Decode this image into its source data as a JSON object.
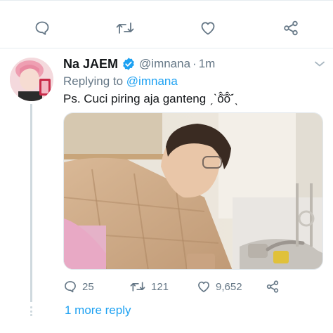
{
  "top_actions": {
    "reply_icon": "reply-icon",
    "retweet_icon": "retweet-icon",
    "like_icon": "heart-icon",
    "share_icon": "share-icon"
  },
  "tweet": {
    "display_name": "Na JAEM",
    "handle": "@imnana",
    "separator": "·",
    "time": "1m",
    "replying_prefix": "Replying to",
    "replying_to": "@imnana",
    "text": "Ps. Cuci piring aja ganteng ˏˋô̂̆ô̂̆ˊˎ",
    "media_alt": "Person washing dishes at a kitchen sink",
    "counts": {
      "replies": "25",
      "retweets": "121",
      "likes": "9,652"
    }
  },
  "thread": {
    "more_reply_label": "1 more reply"
  },
  "colors": {
    "accent": "#1da1f2",
    "secondary_text": "#657786",
    "primary_text": "#14171a",
    "divider": "#e6ecf0"
  }
}
